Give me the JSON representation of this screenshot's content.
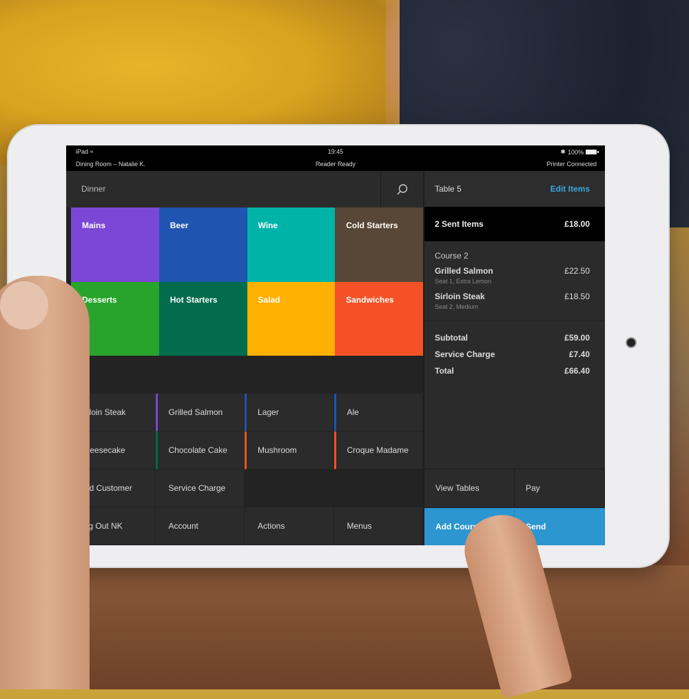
{
  "statusbar": {
    "device": "iPad",
    "time": "19:45",
    "battery": "100%",
    "location": "Dining Room – Natalie K.",
    "reader": "Reader Ready",
    "printer": "Printer Connected"
  },
  "menu": {
    "title": "Dinner",
    "categories": [
      {
        "label": "Mains",
        "color": "#7b47d6"
      },
      {
        "label": "Beer",
        "color": "#1f55b0"
      },
      {
        "label": "Wine",
        "color": "#00b3a9"
      },
      {
        "label": "Cold Starters",
        "color": "#584636"
      },
      {
        "label": "Desserts",
        "color": "#28a42c"
      },
      {
        "label": "Hot Starters",
        "color": "#026c4d"
      },
      {
        "label": "Salad",
        "color": "#ffb000"
      },
      {
        "label": "Sandwiches",
        "color": "#f45226"
      }
    ],
    "items": [
      {
        "label": "Sirloin Steak",
        "color": "#7b47d6"
      },
      {
        "label": "Grilled Salmon",
        "color": "#7b47d6"
      },
      {
        "label": "Lager",
        "color": "#1f55b0"
      },
      {
        "label": "Ale",
        "color": "#1f55b0"
      },
      {
        "label": "Cheesecake",
        "color": "#026c4d"
      },
      {
        "label": "Chocolate Cake",
        "color": "#026c4d"
      },
      {
        "label": "Mushroom",
        "color": "#f45226"
      },
      {
        "label": "Croque Madame",
        "color": "#f45226"
      }
    ],
    "actions": [
      "Add Customer",
      "Service Charge",
      "Log Out NK",
      "Account",
      "Actions",
      "Menus"
    ]
  },
  "ticket": {
    "table": "Table 5",
    "edit": "Edit Items",
    "sent_label": "2 Sent Items",
    "sent_total": "£18.00",
    "course": "Course 2",
    "lines": [
      {
        "name": "Grilled Salmon",
        "price": "£22.50",
        "mod": "Seat 1, Extra Lemon"
      },
      {
        "name": "Sirloin Steak",
        "price": "£18.50",
        "mod": "Seat 2, Medium"
      }
    ],
    "subtotal_label": "Subtotal",
    "subtotal": "£59.00",
    "service_label": "Service Charge",
    "service": "£7.40",
    "total_label": "Total",
    "total": "£66.40",
    "buttons": {
      "view_tables": "View Tables",
      "pay": "Pay",
      "add_course": "Add Course",
      "send": "Send"
    }
  }
}
